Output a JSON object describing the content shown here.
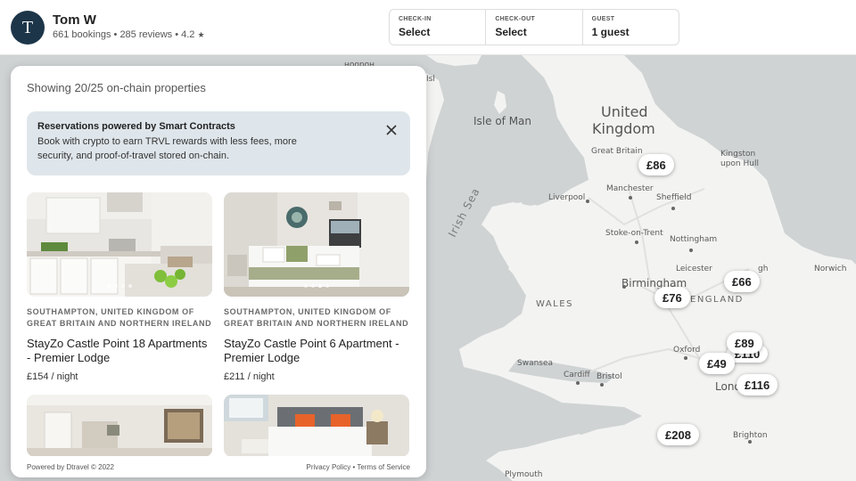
{
  "host": {
    "initial": "T",
    "name": "Tom W",
    "bookings": "661 bookings",
    "reviews": "285 reviews",
    "rating": "4.2",
    "star": "★",
    "separator": "•"
  },
  "booking": {
    "checkin_label": "CHECK-IN",
    "checkin_value": "Select",
    "checkout_label": "CHECK-OUT",
    "checkout_value": "Select",
    "guest_label": "GUEST",
    "guest_value": "1 guest"
  },
  "panel": {
    "showing": "Showing 20/25 on-chain properties",
    "banner_title": "Reservations powered by Smart Contracts",
    "banner_body": "Book with crypto to earn TRVL rewards with less fees, more security, and proof-of-travel stored on-chain."
  },
  "listings": [
    {
      "location": "SOUTHAMPTON, UNITED KINGDOM OF GREAT BRITAIN AND NORTHERN IRELAND",
      "title": "StayZo Castle Point 18 Apartments - Premier Lodge",
      "price": "£154 / night",
      "image": "kitchen",
      "active_dot": 0
    },
    {
      "location": "SOUTHAMPTON, UNITED KINGDOM OF GREAT BRITAIN AND NORTHERN IRELAND",
      "title": "StayZo Castle Point 6 Apartment - Premier Lodge",
      "price": "£211 / night",
      "image": "bedroom",
      "active_dot": 2
    }
  ],
  "footer": {
    "powered": "Powered by Dtravel © 2022",
    "privacy": "Privacy Policy",
    "sep": "•",
    "terms": "Terms of Service"
  },
  "map": {
    "labels": {
      "united_kingdom_1": "United",
      "united_kingdom_2": "Kingdom",
      "isle_of_man": "Isle of Man",
      "irish_sea": "Irish Sea",
      "great_britain": "Great Britain",
      "kingston_1": "Kingston",
      "kingston_2": "upon Hull",
      "manchester": "Manchester",
      "liverpool": "Liverpool",
      "sheffield": "Sheffield",
      "stoke": "Stoke-on-Trent",
      "nottingham": "Nottingham",
      "leicester": "Leicester",
      "birmingham": "Birmingham",
      "norwich": "Norwich",
      "england": "ENGLAND",
      "wales": "WALES",
      "oxford": "Oxford",
      "swansea": "Swansea",
      "cardiff": "Cardiff",
      "bristol": "Bristol",
      "london": "Lond",
      "brighton": "Brighton",
      "plymouth": "Plymouth",
      "edge_top": "Isl",
      "edge_gh": "gh"
    },
    "prices": [
      "£86",
      "£76",
      "£66",
      "£89",
      "£110",
      "£49",
      "£116",
      "£208"
    ]
  },
  "colors": {
    "sea": "#cfd3d4",
    "land": "#f3f3f2",
    "avatar": "#1d3548",
    "banner": "#dfe6eb"
  }
}
